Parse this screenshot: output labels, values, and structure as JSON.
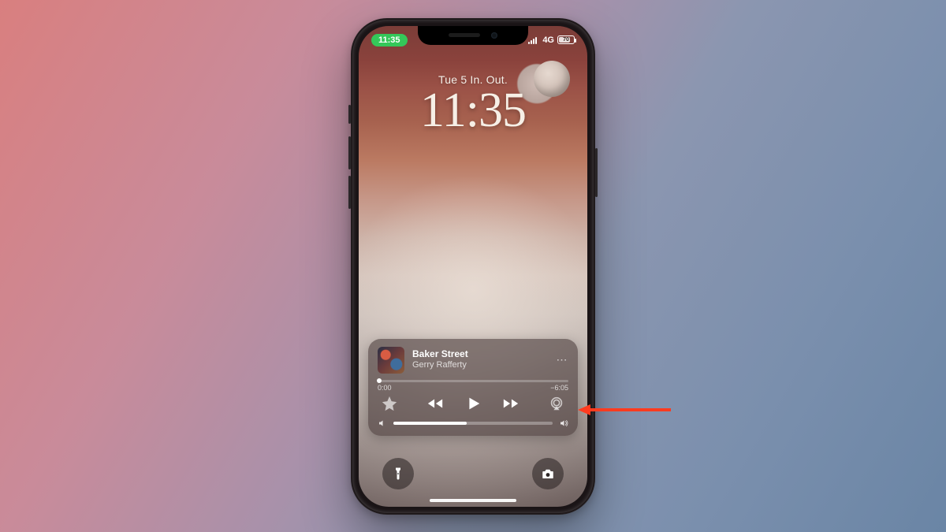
{
  "status": {
    "time_pill": "11:35",
    "network": "4G",
    "battery_pct": "70"
  },
  "lockscreen": {
    "date": "Tue 5  In. Out.",
    "time": "11:35"
  },
  "music": {
    "title": "Baker Street",
    "artist": "Gerry Rafferty",
    "elapsed": "0:00",
    "remaining": "−6:05",
    "progress_pct": 1,
    "volume_pct": 46
  },
  "icons": {
    "more": "more-icon",
    "favorite": "star-icon",
    "rewind": "rewind-icon",
    "play": "play-icon",
    "forward": "forward-icon",
    "airplay": "airplay-icon",
    "vol_low": "volume-low-icon",
    "vol_high": "volume-high-icon",
    "flashlight": "flashlight-icon",
    "camera": "camera-icon"
  }
}
